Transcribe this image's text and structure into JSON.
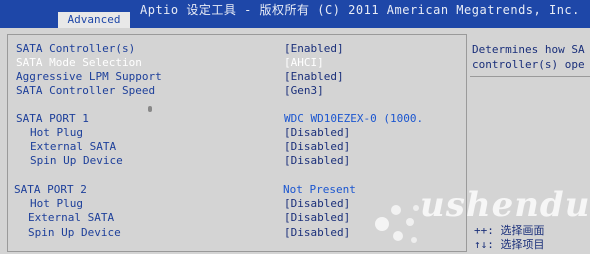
{
  "header": {
    "title": "Aptio 设定工具 - 版权所有 (C) 2011 American Megatrends, Inc.",
    "active_tab": "Advanced"
  },
  "settings": [
    {
      "label": "SATA Controller(s)",
      "value": "[Enabled]"
    },
    {
      "label": "SATA Mode Selection",
      "value": "[AHCI]",
      "selected": true
    },
    {
      "label": "Aggressive LPM Support",
      "value": "[Enabled]"
    },
    {
      "label": "SATA Controller Speed",
      "value": "[Gen3]"
    },
    {
      "label": "SATA PORT 1",
      "value": "WDC WD10EZEX-0 (1000."
    },
    {
      "label": "Hot Plug",
      "value": "[Disabled]"
    },
    {
      "label": "External SATA",
      "value": "[Disabled]"
    },
    {
      "label": "Spin Up Device",
      "value": "[Disabled]"
    },
    {
      "label": "SATA PORT 2",
      "value": "Not Present"
    },
    {
      "label": "Hot Plug",
      "value": "[Disabled]"
    },
    {
      "label": "External SATA",
      "value": "[Disabled]"
    },
    {
      "label": "Spin Up Device",
      "value": "[Disabled]"
    }
  ],
  "help": {
    "description": "Determines how SA\ncontroller(s) ope",
    "keys": [
      "++: 选择画面",
      "↑↓: 选择项目"
    ]
  },
  "watermark": "ushendu",
  "colors": {
    "title_bar": "#1e47a8",
    "background": "#d4d4d4",
    "label": "#1d3f9a",
    "value": "#1a2f7a",
    "selected": "#ffffff",
    "device_value": "#1b56d0"
  }
}
